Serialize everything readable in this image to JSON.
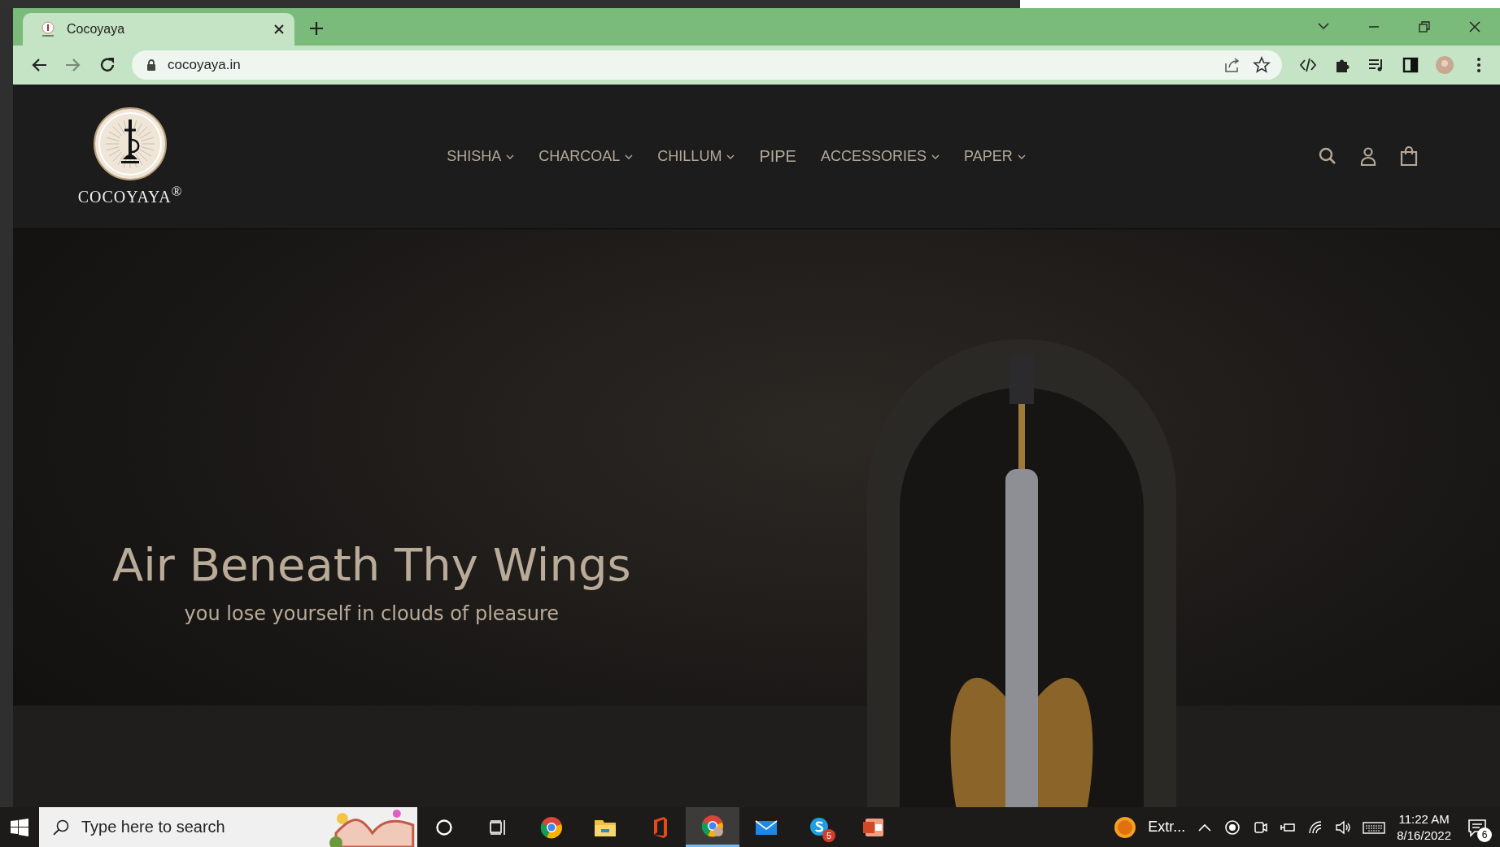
{
  "browser": {
    "tab": {
      "title": "Cocoyaya",
      "selected": true
    },
    "address": "cocoyaya.in"
  },
  "site": {
    "logo_text": "COCOYAYA$^{®}$",
    "nav": [
      {
        "label": "SHISHA",
        "kind": "dropdown"
      },
      {
        "label": "CHARCOAL",
        "kind": "dropdown"
      },
      {
        "label": "CHILLUM",
        "kind": "dropdown"
      },
      {
        "label": "PIPE",
        "kind": "link"
      },
      {
        "label": "ACCESSORIES",
        "kind": "dropdown"
      },
      {
        "label": "PAPER",
        "kind": "dropdown"
      }
    ],
    "hero": {
      "title": "Air Beneath Thy Wings",
      "subtitle": "you lose yourself in clouds of pleasure"
    }
  },
  "taskbar": {
    "search_placeholder": "Type here to search",
    "apps": [
      {
        "kind": "chrome",
        "selected": false
      },
      {
        "kind": "folder",
        "selected": false
      },
      {
        "kind": "office",
        "selected": false
      },
      {
        "kind": "chrome-profile",
        "selected": true
      },
      {
        "kind": "mail",
        "selected": false
      },
      {
        "kind": "skype",
        "selected": false,
        "badge": "5"
      },
      {
        "kind": "slides",
        "selected": false
      }
    ],
    "tray_app": "Extr...",
    "time": "11:22 AM",
    "date": "8/16/2022",
    "notifications": "6"
  }
}
